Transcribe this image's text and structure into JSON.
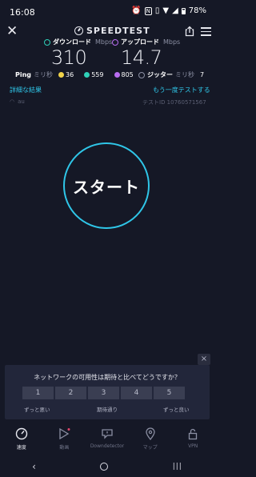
{
  "status_bar": {
    "time": "16:08",
    "battery": "78%"
  },
  "header": {
    "logo_text": "SPEEDTEST"
  },
  "download": {
    "label": "ダウンロード",
    "unit": "Mbps",
    "value": "310"
  },
  "upload": {
    "label": "アップロード",
    "unit": "Mbps",
    "value": "14.7"
  },
  "ping": {
    "label": "Ping",
    "unit": "ミリ秒",
    "idle": "36",
    "download": "559",
    "upload": "805"
  },
  "jitter": {
    "label": "ジッター",
    "unit": "ミリ秒",
    "value": "7"
  },
  "links": {
    "details": "詳細な結果",
    "retest": "もう一度テストする"
  },
  "meta": {
    "isp": "au",
    "test_id": "テストID 10760571567"
  },
  "start_button": {
    "label": "スタート"
  },
  "survey": {
    "question": "ネットワークの可用性は期待と比べてどうですか？",
    "options": [
      "1",
      "2",
      "3",
      "4",
      "5"
    ],
    "low_label": "ずっと悪い",
    "mid_label": "期待通り",
    "high_label": "ずっと良い",
    "close": "×"
  },
  "nav": {
    "items": [
      {
        "label": "速度",
        "icon": "speedometer-icon"
      },
      {
        "label": "動画",
        "icon": "video-icon"
      },
      {
        "label": "Downdetector",
        "icon": "downdetector-icon"
      },
      {
        "label": "マップ",
        "icon": "map-pin-icon"
      },
      {
        "label": "VPN",
        "icon": "lock-icon"
      }
    ]
  },
  "colors": {
    "background": "#151826",
    "accent": "#2fc6e8",
    "download": "#2fd0b8",
    "upload": "#b86cf0",
    "idle_ping": "#f1d34a"
  }
}
